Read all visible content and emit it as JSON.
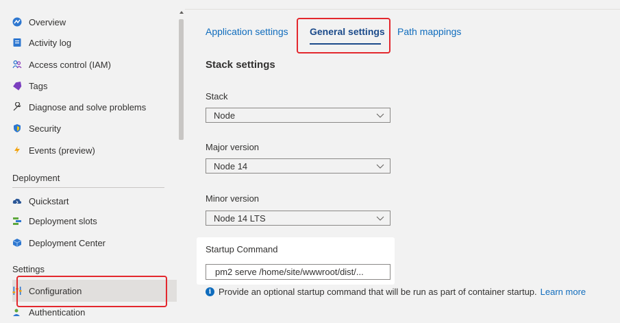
{
  "sidebar": {
    "items": [
      {
        "label": "Overview",
        "icon": "overview-icon"
      },
      {
        "label": "Activity log",
        "icon": "activity-log-icon"
      },
      {
        "label": "Access control (IAM)",
        "icon": "people-icon"
      },
      {
        "label": "Tags",
        "icon": "tag-icon"
      },
      {
        "label": "Diagnose and solve problems",
        "icon": "wrench-icon"
      },
      {
        "label": "Security",
        "icon": "shield-icon"
      },
      {
        "label": "Events (preview)",
        "icon": "lightning-icon"
      }
    ],
    "deployment_heading": "Deployment",
    "deployment_items": [
      {
        "label": "Quickstart",
        "icon": "cloud-icon"
      },
      {
        "label": "Deployment slots",
        "icon": "slots-icon"
      },
      {
        "label": "Deployment Center",
        "icon": "cube-icon"
      }
    ],
    "settings_heading": "Settings",
    "settings_items": [
      {
        "label": "Configuration",
        "icon": "sliders-icon",
        "selected": true
      },
      {
        "label": "Authentication",
        "icon": "person-icon"
      }
    ]
  },
  "tabs": [
    {
      "label": "Application settings",
      "active": false
    },
    {
      "label": "General settings",
      "active": true
    },
    {
      "label": "Path mappings",
      "active": false
    }
  ],
  "stack_settings": {
    "heading": "Stack settings",
    "stack": {
      "label": "Stack",
      "value": "Node"
    },
    "major_version": {
      "label": "Major version",
      "value": "Node 14"
    },
    "minor_version": {
      "label": "Minor version",
      "value": "Node 14 LTS"
    }
  },
  "startup": {
    "label": "Startup Command",
    "value": "pm2 serve /home/site/wwwroot/dist/...",
    "info_text": "Provide an optional startup command that will be run as part of container startup.",
    "learn_more": "Learn more"
  },
  "colors": {
    "accent": "#0f6cbd",
    "highlight_border": "#e3272d",
    "active_tab": "#1b4a8a"
  }
}
